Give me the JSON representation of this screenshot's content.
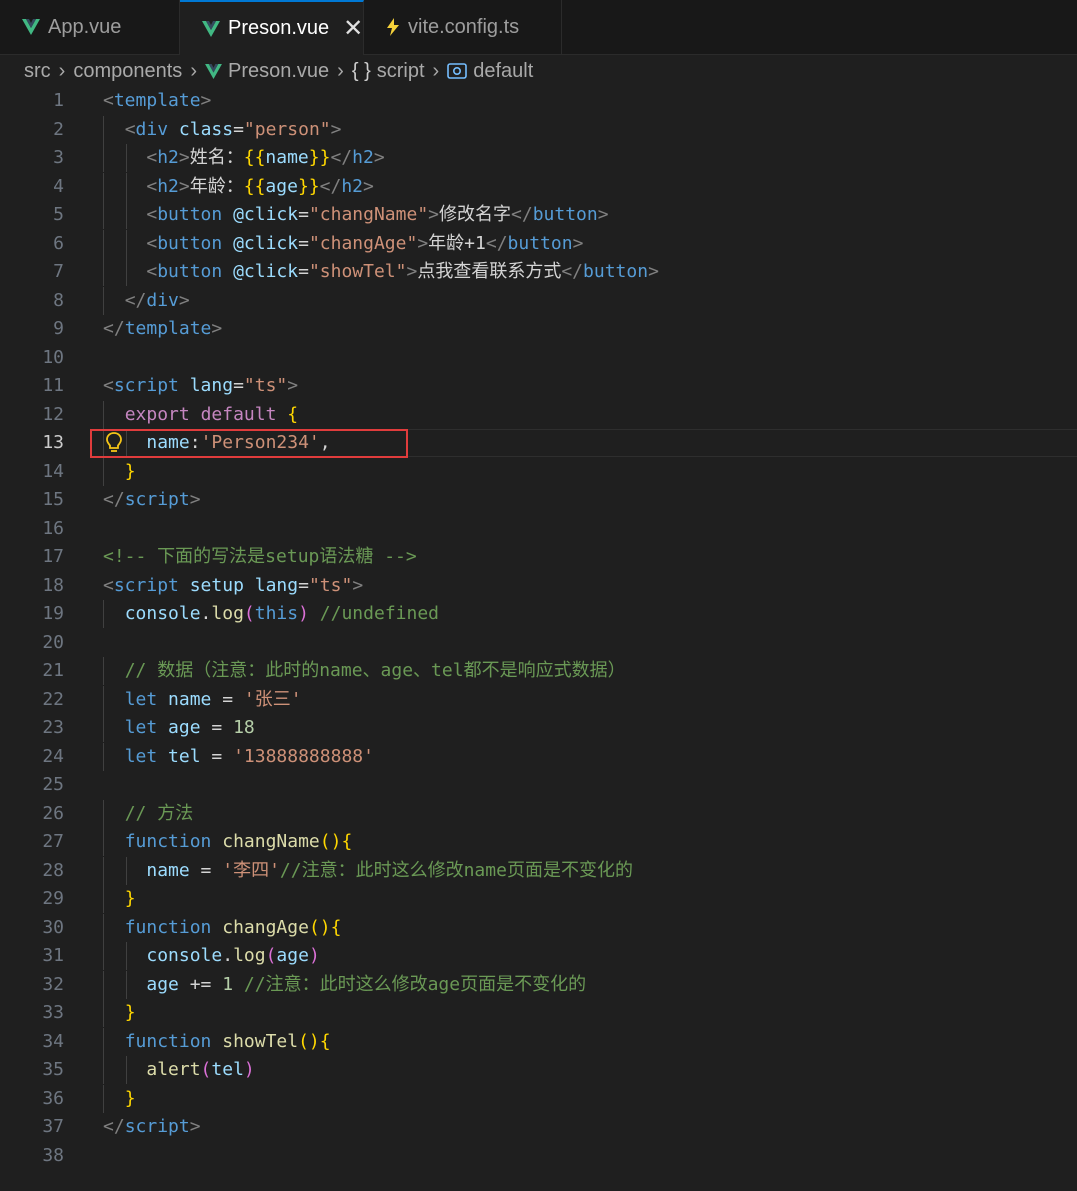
{
  "tabs": [
    {
      "label": "App.vue",
      "icon": "vue-icon",
      "active": false
    },
    {
      "label": "Preson.vue",
      "icon": "vue-icon",
      "active": true,
      "close": "✕"
    },
    {
      "label": "vite.config.ts",
      "icon": "lightning-icon",
      "active": false
    }
  ],
  "breadcrumb": {
    "items": [
      "src",
      "components",
      "Preson.vue",
      "script",
      "default"
    ],
    "script_prefix": "{ }"
  },
  "editor": {
    "current_line": 13,
    "lines": [
      [
        [
          "tk-punc",
          "<"
        ],
        [
          "tk-tag",
          "template"
        ],
        [
          "tk-punc",
          ">"
        ]
      ],
      [
        [
          "tk-ws",
          "  "
        ],
        [
          "tk-punc",
          "<"
        ],
        [
          "tk-tag",
          "div"
        ],
        [
          "tk-ws",
          " "
        ],
        [
          "tk-attr",
          "class"
        ],
        [
          "tk-ws",
          "="
        ],
        [
          "tk-str",
          "\"person\""
        ],
        [
          "tk-punc",
          ">"
        ]
      ],
      [
        [
          "tk-ws",
          "    "
        ],
        [
          "tk-punc",
          "<"
        ],
        [
          "tk-tag",
          "h2"
        ],
        [
          "tk-punc",
          ">"
        ],
        [
          "tk-txt",
          "姓名："
        ],
        [
          "tk-brace",
          "{{"
        ],
        [
          "tk-var",
          "name"
        ],
        [
          "tk-brace",
          "}}"
        ],
        [
          "tk-punc",
          "</"
        ],
        [
          "tk-tag",
          "h2"
        ],
        [
          "tk-punc",
          ">"
        ]
      ],
      [
        [
          "tk-ws",
          "    "
        ],
        [
          "tk-punc",
          "<"
        ],
        [
          "tk-tag",
          "h2"
        ],
        [
          "tk-punc",
          ">"
        ],
        [
          "tk-txt",
          "年龄："
        ],
        [
          "tk-brace",
          "{{"
        ],
        [
          "tk-var",
          "age"
        ],
        [
          "tk-brace",
          "}}"
        ],
        [
          "tk-punc",
          "</"
        ],
        [
          "tk-tag",
          "h2"
        ],
        [
          "tk-punc",
          ">"
        ]
      ],
      [
        [
          "tk-ws",
          "    "
        ],
        [
          "tk-punc",
          "<"
        ],
        [
          "tk-tag",
          "button"
        ],
        [
          "tk-ws",
          " "
        ],
        [
          "tk-attr",
          "@click"
        ],
        [
          "tk-ws",
          "="
        ],
        [
          "tk-str",
          "\"changName\""
        ],
        [
          "tk-punc",
          ">"
        ],
        [
          "tk-txt",
          "修改名字"
        ],
        [
          "tk-punc",
          "</"
        ],
        [
          "tk-tag",
          "button"
        ],
        [
          "tk-punc",
          ">"
        ]
      ],
      [
        [
          "tk-ws",
          "    "
        ],
        [
          "tk-punc",
          "<"
        ],
        [
          "tk-tag",
          "button"
        ],
        [
          "tk-ws",
          " "
        ],
        [
          "tk-attr",
          "@click"
        ],
        [
          "tk-ws",
          "="
        ],
        [
          "tk-str",
          "\"changAge\""
        ],
        [
          "tk-punc",
          ">"
        ],
        [
          "tk-txt",
          "年龄+1"
        ],
        [
          "tk-punc",
          "</"
        ],
        [
          "tk-tag",
          "button"
        ],
        [
          "tk-punc",
          ">"
        ]
      ],
      [
        [
          "tk-ws",
          "    "
        ],
        [
          "tk-punc",
          "<"
        ],
        [
          "tk-tag",
          "button"
        ],
        [
          "tk-ws",
          " "
        ],
        [
          "tk-attr",
          "@click"
        ],
        [
          "tk-ws",
          "="
        ],
        [
          "tk-str",
          "\"showTel\""
        ],
        [
          "tk-punc",
          ">"
        ],
        [
          "tk-txt",
          "点我查看联系方式"
        ],
        [
          "tk-punc",
          "</"
        ],
        [
          "tk-tag",
          "button"
        ],
        [
          "tk-punc",
          ">"
        ]
      ],
      [
        [
          "tk-ws",
          "  "
        ],
        [
          "tk-punc",
          "</"
        ],
        [
          "tk-tag",
          "div"
        ],
        [
          "tk-punc",
          ">"
        ]
      ],
      [
        [
          "tk-punc",
          "</"
        ],
        [
          "tk-tag",
          "template"
        ],
        [
          "tk-punc",
          ">"
        ]
      ],
      [],
      [
        [
          "tk-punc",
          "<"
        ],
        [
          "tk-tag",
          "script"
        ],
        [
          "tk-ws",
          " "
        ],
        [
          "tk-attr",
          "lang"
        ],
        [
          "tk-ws",
          "="
        ],
        [
          "tk-str",
          "\"ts\""
        ],
        [
          "tk-punc",
          ">"
        ]
      ],
      [
        [
          "tk-ws",
          "  "
        ],
        [
          "tk-kw",
          "export"
        ],
        [
          "tk-ws",
          " "
        ],
        [
          "tk-kw",
          "default"
        ],
        [
          "tk-ws",
          " "
        ],
        [
          "tk-brace",
          "{"
        ]
      ],
      [
        [
          "tk-ws",
          "    "
        ],
        [
          "tk-var",
          "name"
        ],
        [
          "tk-ws",
          ":"
        ],
        [
          "tk-str",
          "'Person234'"
        ],
        [
          "tk-ws",
          ","
        ]
      ],
      [
        [
          "tk-ws",
          "  "
        ],
        [
          "tk-brace",
          "}"
        ]
      ],
      [
        [
          "tk-punc",
          "</"
        ],
        [
          "tk-tag",
          "script"
        ],
        [
          "tk-punc",
          ">"
        ]
      ],
      [],
      [
        [
          "tk-com",
          "<!-- 下面的写法是setup语法糖 -->"
        ]
      ],
      [
        [
          "tk-punc",
          "<"
        ],
        [
          "tk-tag",
          "script"
        ],
        [
          "tk-ws",
          " "
        ],
        [
          "tk-attr",
          "setup"
        ],
        [
          "tk-ws",
          " "
        ],
        [
          "tk-attr",
          "lang"
        ],
        [
          "tk-ws",
          "="
        ],
        [
          "tk-str",
          "\"ts\""
        ],
        [
          "tk-punc",
          ">"
        ]
      ],
      [
        [
          "tk-ws",
          "  "
        ],
        [
          "tk-var",
          "console"
        ],
        [
          "tk-ws",
          "."
        ],
        [
          "tk-fn",
          "log"
        ],
        [
          "tk-par",
          "("
        ],
        [
          "tk-decl",
          "this"
        ],
        [
          "tk-par",
          ")"
        ],
        [
          "tk-ws",
          " "
        ],
        [
          "tk-com",
          "//undefined"
        ]
      ],
      [],
      [
        [
          "tk-ws",
          "  "
        ],
        [
          "tk-com",
          "// 数据（注意：此时的name、age、tel都不是响应式数据）"
        ]
      ],
      [
        [
          "tk-ws",
          "  "
        ],
        [
          "tk-decl",
          "let"
        ],
        [
          "tk-ws",
          " "
        ],
        [
          "tk-var",
          "name"
        ],
        [
          "tk-ws",
          " = "
        ],
        [
          "tk-str",
          "'张三'"
        ]
      ],
      [
        [
          "tk-ws",
          "  "
        ],
        [
          "tk-decl",
          "let"
        ],
        [
          "tk-ws",
          " "
        ],
        [
          "tk-var",
          "age"
        ],
        [
          "tk-ws",
          " = "
        ],
        [
          "tk-num",
          "18"
        ]
      ],
      [
        [
          "tk-ws",
          "  "
        ],
        [
          "tk-decl",
          "let"
        ],
        [
          "tk-ws",
          " "
        ],
        [
          "tk-var",
          "tel"
        ],
        [
          "tk-ws",
          " = "
        ],
        [
          "tk-str",
          "'13888888888'"
        ]
      ],
      [],
      [
        [
          "tk-ws",
          "  "
        ],
        [
          "tk-com",
          "// 方法"
        ]
      ],
      [
        [
          "tk-ws",
          "  "
        ],
        [
          "tk-decl",
          "function"
        ],
        [
          "tk-ws",
          " "
        ],
        [
          "tk-fn",
          "changName"
        ],
        [
          "tk-brace",
          "(){"
        ]
      ],
      [
        [
          "tk-ws",
          "    "
        ],
        [
          "tk-var",
          "name"
        ],
        [
          "tk-ws",
          " = "
        ],
        [
          "tk-str",
          "'李四'"
        ],
        [
          "tk-com",
          "//注意：此时这么修改name页面是不变化的"
        ]
      ],
      [
        [
          "tk-ws",
          "  "
        ],
        [
          "tk-brace",
          "}"
        ]
      ],
      [
        [
          "tk-ws",
          "  "
        ],
        [
          "tk-decl",
          "function"
        ],
        [
          "tk-ws",
          " "
        ],
        [
          "tk-fn",
          "changAge"
        ],
        [
          "tk-brace",
          "(){"
        ]
      ],
      [
        [
          "tk-ws",
          "    "
        ],
        [
          "tk-var",
          "console"
        ],
        [
          "tk-ws",
          "."
        ],
        [
          "tk-fn",
          "log"
        ],
        [
          "tk-par",
          "("
        ],
        [
          "tk-var",
          "age"
        ],
        [
          "tk-par",
          ")"
        ]
      ],
      [
        [
          "tk-ws",
          "    "
        ],
        [
          "tk-var",
          "age"
        ],
        [
          "tk-ws",
          " += "
        ],
        [
          "tk-num",
          "1"
        ],
        [
          "tk-ws",
          " "
        ],
        [
          "tk-com",
          "//注意：此时这么修改age页面是不变化的"
        ]
      ],
      [
        [
          "tk-ws",
          "  "
        ],
        [
          "tk-brace",
          "}"
        ]
      ],
      [
        [
          "tk-ws",
          "  "
        ],
        [
          "tk-decl",
          "function"
        ],
        [
          "tk-ws",
          " "
        ],
        [
          "tk-fn",
          "showTel"
        ],
        [
          "tk-brace",
          "(){"
        ]
      ],
      [
        [
          "tk-ws",
          "    "
        ],
        [
          "tk-fn",
          "alert"
        ],
        [
          "tk-par",
          "("
        ],
        [
          "tk-var",
          "tel"
        ],
        [
          "tk-par",
          ")"
        ]
      ],
      [
        [
          "tk-ws",
          "  "
        ],
        [
          "tk-brace",
          "}"
        ]
      ],
      [
        [
          "tk-punc",
          "</"
        ],
        [
          "tk-tag",
          "script"
        ],
        [
          "tk-punc",
          ">"
        ]
      ],
      []
    ]
  },
  "colors": {
    "highlight_box": "#e03c3c",
    "vue_logo": "#41b883",
    "lightning": "#f5d13a"
  }
}
